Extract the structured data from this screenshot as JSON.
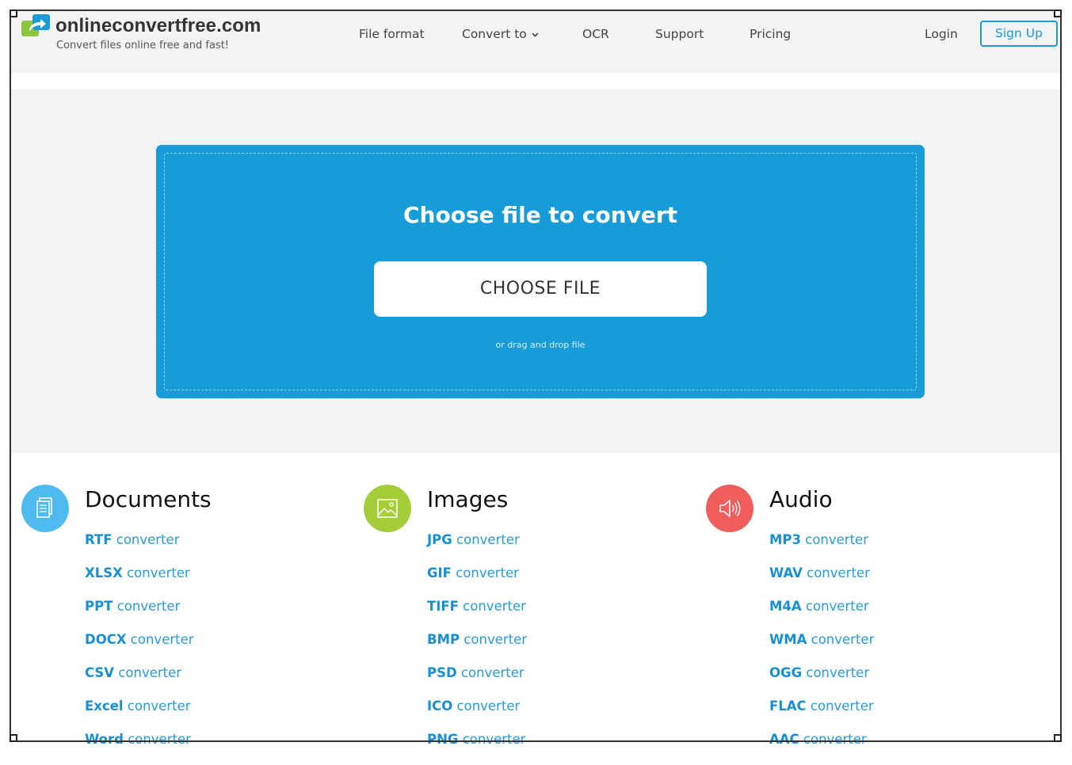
{
  "brand": {
    "name": "onlineconvertfree.com",
    "tagline": "Convert files online free and fast!"
  },
  "nav": {
    "items": [
      {
        "label": "File format"
      },
      {
        "label": "Convert to",
        "has_dropdown": true
      },
      {
        "label": "OCR"
      },
      {
        "label": "Support"
      },
      {
        "label": "Pricing"
      }
    ],
    "login": "Login",
    "signup": "Sign Up"
  },
  "upload": {
    "title": "Choose file to convert",
    "button": "CHOOSE FILE",
    "hint": "or drag and drop file"
  },
  "categories": [
    {
      "title": "Documents",
      "icon": "document-icon",
      "color": "#4ebbef",
      "links": [
        {
          "format": "RTF",
          "suffix": " converter"
        },
        {
          "format": "XLSX",
          "suffix": " converter"
        },
        {
          "format": "PPT",
          "suffix": " converter"
        },
        {
          "format": "DOCX",
          "suffix": " converter"
        },
        {
          "format": "CSV",
          "suffix": " converter"
        },
        {
          "format": "Excel",
          "suffix": " converter"
        },
        {
          "format": "Word",
          "suffix": " converter"
        }
      ]
    },
    {
      "title": "Images",
      "icon": "image-icon",
      "color": "#a4cd39",
      "links": [
        {
          "format": "JPG",
          "suffix": " converter"
        },
        {
          "format": "GIF",
          "suffix": " converter"
        },
        {
          "format": "TIFF",
          "suffix": " converter"
        },
        {
          "format": "BMP",
          "suffix": " converter"
        },
        {
          "format": "PSD",
          "suffix": " converter"
        },
        {
          "format": "ICO",
          "suffix": " converter"
        },
        {
          "format": "PNG",
          "suffix": " converter"
        }
      ]
    },
    {
      "title": "Audio",
      "icon": "speaker-icon",
      "color": "#ef5d5d",
      "links": [
        {
          "format": "MP3",
          "suffix": " converter"
        },
        {
          "format": "WAV",
          "suffix": " converter"
        },
        {
          "format": "M4A",
          "suffix": " converter"
        },
        {
          "format": "WMA",
          "suffix": " converter"
        },
        {
          "format": "OGG",
          "suffix": " converter"
        },
        {
          "format": "FLAC",
          "suffix": " converter"
        },
        {
          "format": "AAC",
          "suffix": " converter"
        }
      ]
    }
  ],
  "colors": {
    "accent": "#179cd8",
    "link": "#1a8fd0",
    "page_bg": "#f2f3f4"
  }
}
